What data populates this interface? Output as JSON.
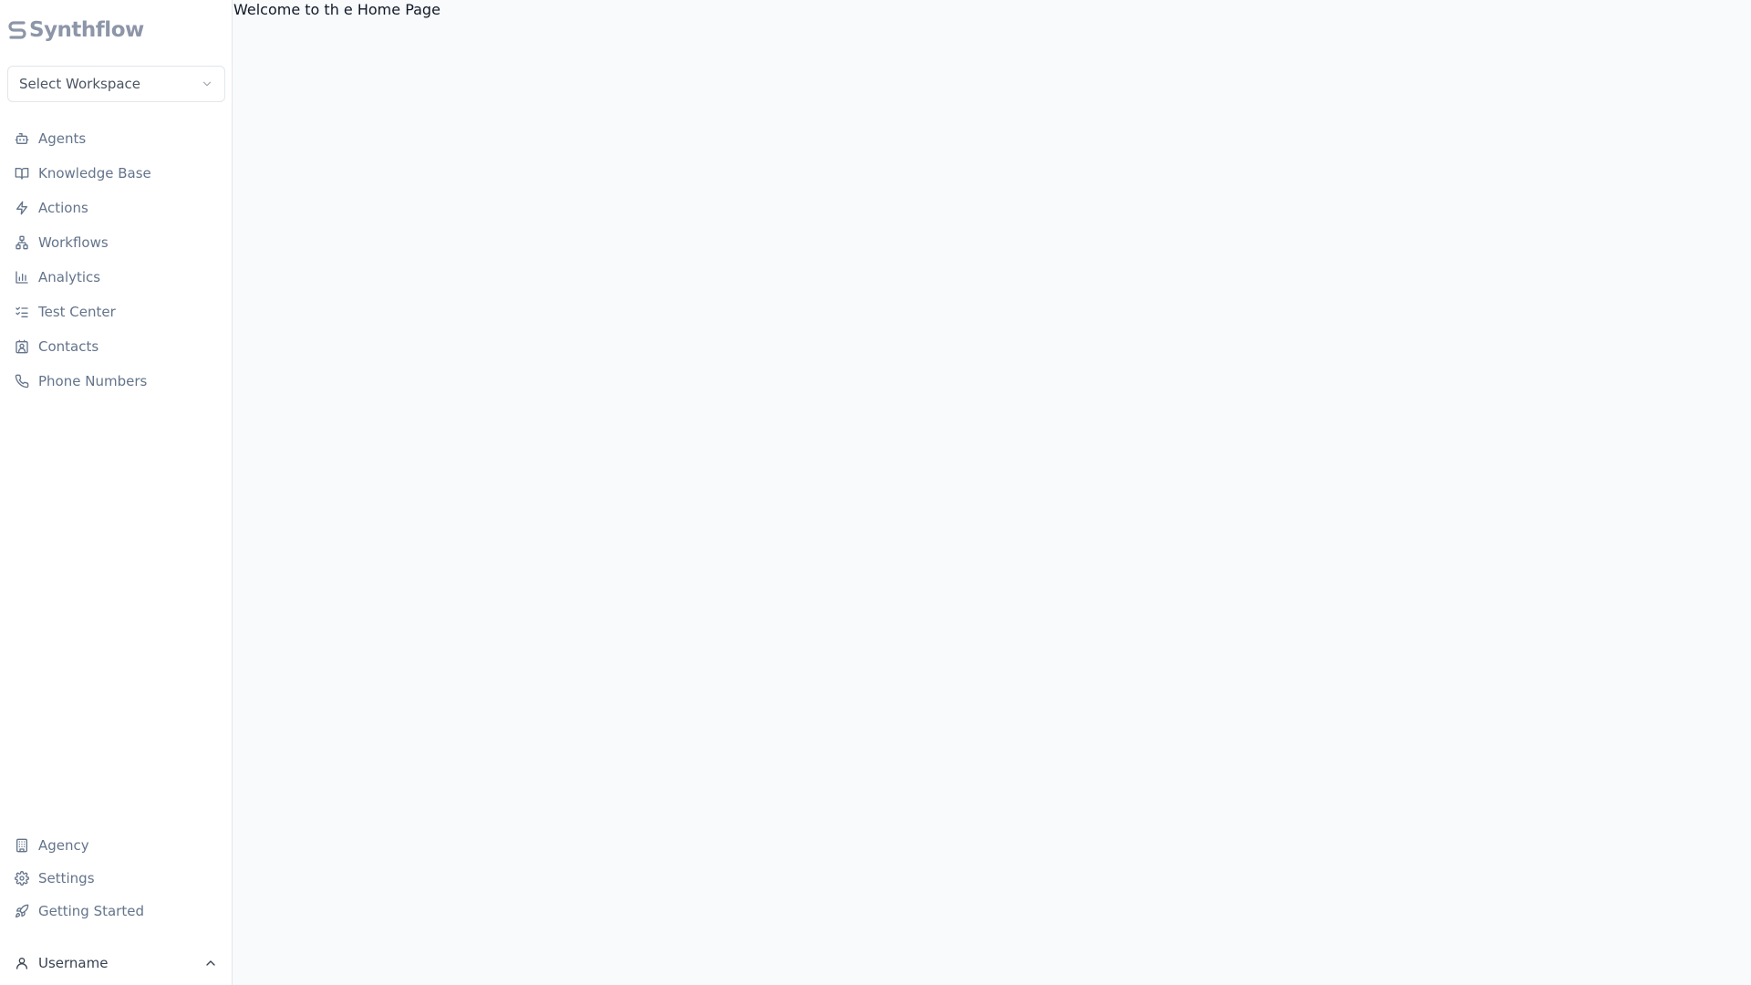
{
  "brand": {
    "name": "Synthflow"
  },
  "workspace": {
    "label": "Select Workspace"
  },
  "nav": {
    "items": [
      {
        "label": "Agents",
        "icon": "bot-icon"
      },
      {
        "label": "Knowledge Base",
        "icon": "book-open-icon"
      },
      {
        "label": "Actions",
        "icon": "zap-icon"
      },
      {
        "label": "Workflows",
        "icon": "workflow-icon"
      },
      {
        "label": "Analytics",
        "icon": "bar-chart-icon"
      },
      {
        "label": "Test Center",
        "icon": "list-checks-icon"
      },
      {
        "label": "Contacts",
        "icon": "contact-icon"
      },
      {
        "label": "Phone Numbers",
        "icon": "phone-icon"
      }
    ]
  },
  "bottom": {
    "items": [
      {
        "label": "Agency",
        "icon": "building-icon"
      },
      {
        "label": "Settings",
        "icon": "gear-icon"
      },
      {
        "label": "Getting Started",
        "icon": "rocket-icon"
      }
    ]
  },
  "user": {
    "label": "Username"
  },
  "main": {
    "welcome": "Welcome to th e Home Page"
  },
  "colors": {
    "sidebar_bg": "#ffffff",
    "main_bg": "#f8fafc",
    "nav_text": "#64748b",
    "logo": "#8d96a8"
  }
}
